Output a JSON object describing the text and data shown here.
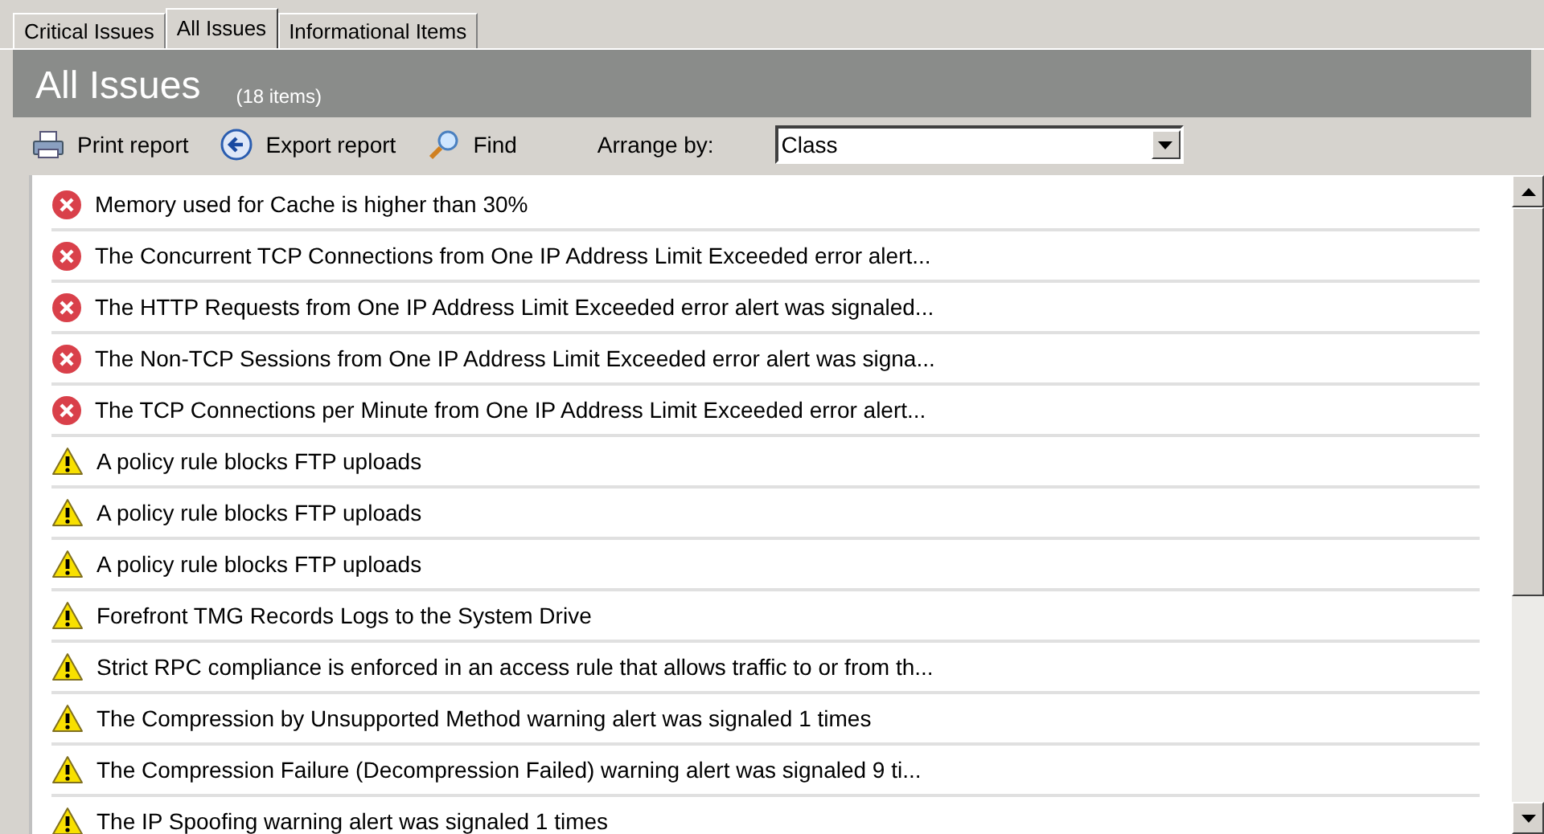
{
  "tabs": [
    {
      "label": "Critical Issues",
      "selected": false
    },
    {
      "label": "All Issues",
      "selected": true
    },
    {
      "label": "Informational Items",
      "selected": false
    }
  ],
  "header": {
    "title": "All Issues",
    "count": "(18 items)"
  },
  "toolbar": {
    "buttons": [
      {
        "kind": "print",
        "label": "Print report"
      },
      {
        "kind": "export",
        "label": "Export report"
      },
      {
        "kind": "find",
        "label": "Find"
      }
    ],
    "arrange_label": "Arrange by:",
    "arrange_value": "Class"
  },
  "issues": [
    {
      "kind": "error",
      "text": "Memory used for Cache is higher than 30%"
    },
    {
      "kind": "error",
      "text": "The Concurrent TCP Connections from One IP Address Limit Exceeded error alert..."
    },
    {
      "kind": "error",
      "text": "The HTTP Requests from One IP Address Limit Exceeded error alert was signaled..."
    },
    {
      "kind": "error",
      "text": "The Non-TCP Sessions from One IP Address Limit Exceeded error alert was signa..."
    },
    {
      "kind": "error",
      "text": "The TCP Connections per Minute from One IP Address Limit Exceeded error alert..."
    },
    {
      "kind": "warning",
      "text": "A policy rule blocks FTP uploads"
    },
    {
      "kind": "warning",
      "text": "A policy rule blocks FTP uploads"
    },
    {
      "kind": "warning",
      "text": "A policy rule blocks FTP uploads"
    },
    {
      "kind": "warning",
      "text": "Forefront TMG Records Logs to the System Drive"
    },
    {
      "kind": "warning",
      "text": "Strict RPC compliance is enforced in an access rule that allows traffic to or from th..."
    },
    {
      "kind": "warning",
      "text": "The Compression by Unsupported Method warning alert was signaled 1 times"
    },
    {
      "kind": "warning",
      "text": "The Compression Failure (Decompression Failed) warning alert was signaled 9 ti..."
    },
    {
      "kind": "warning",
      "text": "The IP Spoofing warning alert was signaled 1 times"
    }
  ]
}
